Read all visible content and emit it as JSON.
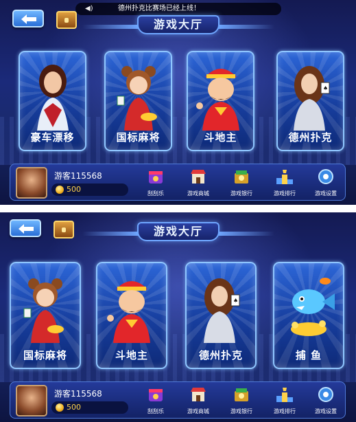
{
  "colors": {
    "accent": "#6fa6ff",
    "coin": "#ffd24a",
    "card_border": "#8fc6ff"
  },
  "notice": {
    "text": "德州扑克比赛场已经上线！",
    "icon": "speaker-icon"
  },
  "top": {
    "title": "游戏大厅",
    "games": [
      {
        "label": "豪车漂移",
        "icon": "racer-girl-icon"
      },
      {
        "label": "国标麻将",
        "icon": "mahjong-girl-icon"
      },
      {
        "label": "斗地主",
        "icon": "landlord-icon"
      },
      {
        "label": "德州扑克",
        "icon": "poker-lady-icon"
      }
    ],
    "user": {
      "name": "游客115568",
      "coins": "500"
    },
    "menu": [
      {
        "label": "刮刮乐",
        "icon": "scratch-card-icon"
      },
      {
        "label": "游戏商城",
        "icon": "shop-icon"
      },
      {
        "label": "游戏银行",
        "icon": "bank-icon"
      },
      {
        "label": "游戏排行",
        "icon": "ranking-podium-icon"
      },
      {
        "label": "游戏设置",
        "icon": "settings-gear-icon"
      }
    ]
  },
  "bottom": {
    "title": "游戏大厅",
    "games": [
      {
        "label": "国标麻将",
        "icon": "mahjong-girl-icon"
      },
      {
        "label": "斗地主",
        "icon": "landlord-icon"
      },
      {
        "label": "德州扑克",
        "icon": "poker-lady-icon"
      },
      {
        "label": "捕 鱼",
        "icon": "fish-icon"
      }
    ],
    "user": {
      "name": "游客115568",
      "coins": "500"
    },
    "menu": [
      {
        "label": "刮刮乐",
        "icon": "scratch-card-icon"
      },
      {
        "label": "游戏商城",
        "icon": "shop-icon"
      },
      {
        "label": "游戏银行",
        "icon": "bank-icon"
      },
      {
        "label": "游戏排行",
        "icon": "ranking-podium-icon"
      },
      {
        "label": "游戏设置",
        "icon": "settings-gear-icon"
      }
    ]
  }
}
